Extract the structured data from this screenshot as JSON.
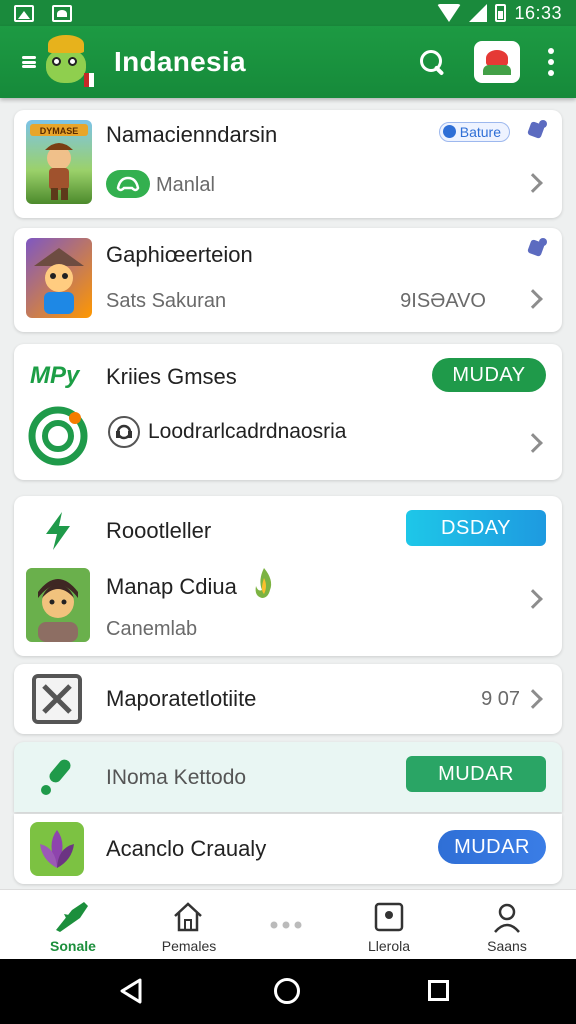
{
  "status_bar": {
    "time": "16:33"
  },
  "app_bar": {
    "title": "Indanesia"
  },
  "cards": [
    {
      "title": "Namacienndarsin",
      "badge": "Bature",
      "subtitle": "Manlal",
      "thumb_text": "DYMASE"
    },
    {
      "title": "Gaphiœerteion",
      "subtitle": "Sats Sakuran",
      "value": "9ISƏAVO"
    },
    {
      "logo_text": "MPy",
      "title": "Kriies Gmses",
      "button": "MUDAY",
      "subtitle": "Loodrarlcadrdnaosria"
    },
    {
      "title": "Roootleller",
      "button": "DSDAY",
      "subtitle_title": "Manap Cdiua",
      "subtitle": "Canemlab"
    },
    {
      "title": "Maporatetlotiite",
      "value": "9 07"
    },
    {
      "title": "INoma Kettodo",
      "button": "MUDAR"
    },
    {
      "title": "Acanclo Craualy",
      "button": "MUDAR"
    }
  ],
  "bottom_nav": {
    "items": [
      {
        "label": "Sonale"
      },
      {
        "label": "Pemales"
      },
      {
        "label": ""
      },
      {
        "label": "Llerola"
      },
      {
        "label": "Saans"
      }
    ]
  },
  "colors": {
    "primary": "#1a8a3c",
    "button_green": "#1f9a4a",
    "button_cyan": "#1ea5e0",
    "button_blue": "#2f6fd6",
    "badge_blue": "#2f6fd6"
  }
}
